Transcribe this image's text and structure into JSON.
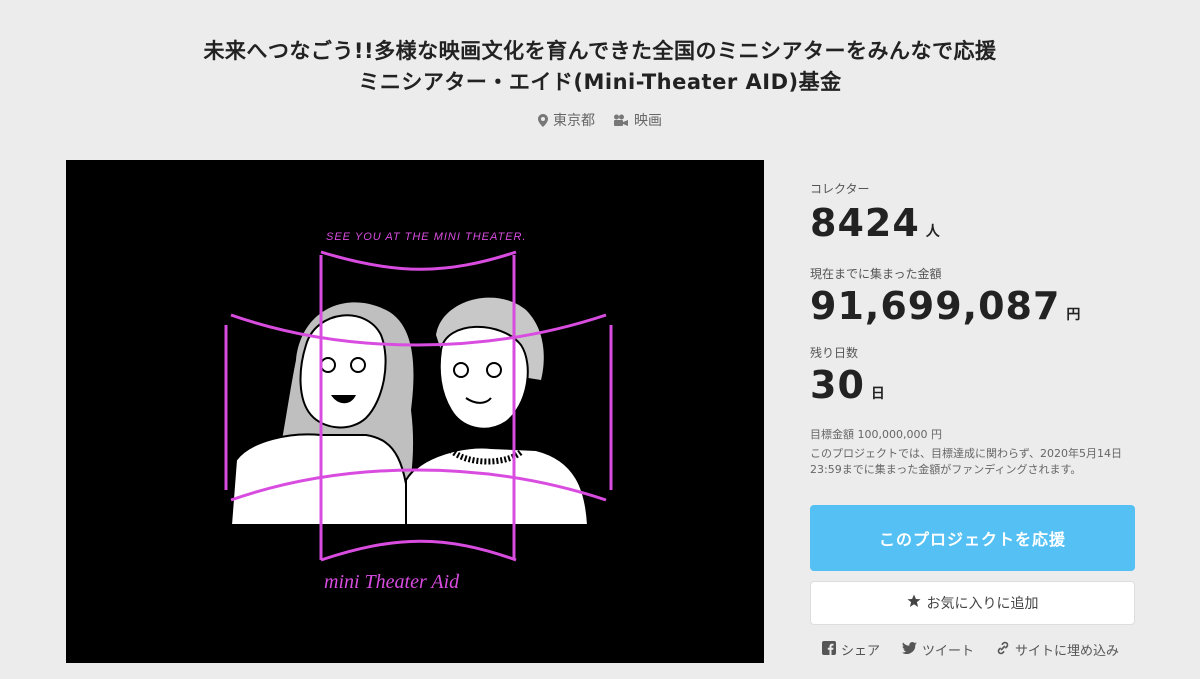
{
  "header": {
    "title_line1": "未来へつなごう!!多様な映画文化を育んできた全国のミニシアターをみんなで応援",
    "title_line2": "ミニシアター・エイド(Mini-Theater AID)基金",
    "location": "東京都",
    "category": "映画"
  },
  "hero": {
    "art_text_top": "SEE YOU AT THE MINI THEATER.",
    "art_text_bottom": "mini Theater Aid"
  },
  "stats": {
    "collectors_label": "コレクター",
    "collectors_value": "8424",
    "collectors_unit": "人",
    "amount_label": "現在までに集まった金額",
    "amount_value": "91,699,087",
    "amount_unit": "円",
    "days_label": "残り日数",
    "days_value": "30",
    "days_unit": "日",
    "goal_text": "目標金額 100,000,000 円",
    "note_text": "このプロジェクトでは、目標達成に関わらず、2020年5月14日23:59までに集まった金額がファンディングされます。"
  },
  "actions": {
    "support_label": "このプロジェクトを応援",
    "favorite_label": "お気に入りに追加",
    "share_label": "シェア",
    "tweet_label": "ツイート",
    "embed_label": "サイトに埋め込み"
  },
  "colors": {
    "support_button": "#55c0f4",
    "accent_magenta": "#d94ce0"
  }
}
